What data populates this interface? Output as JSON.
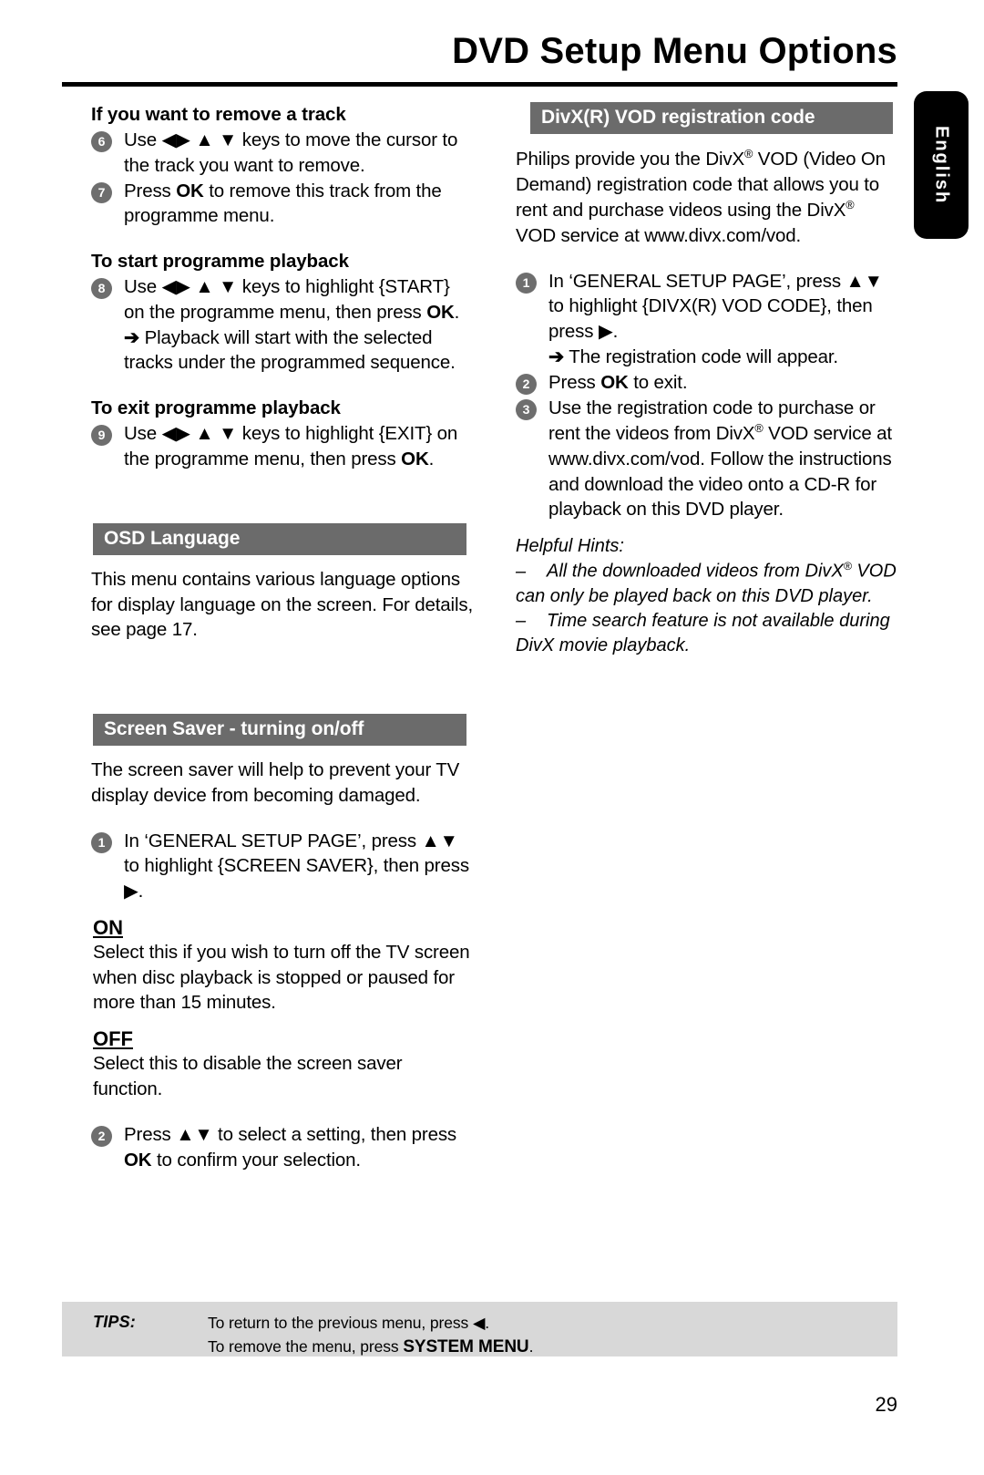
{
  "header": {
    "title": "DVD Setup Menu Options",
    "language_tab": "English"
  },
  "left_column": {
    "remove_track": {
      "heading": "If you want to remove a track",
      "steps": [
        {
          "num": "6",
          "text_pre": "Use ",
          "keys": "◀▶ ▲ ▼",
          "text_post": " keys to move the cursor to the track you want to remove."
        },
        {
          "num": "7",
          "text_pre": "Press ",
          "kbd": "OK",
          "text_post": " to remove this track from the programme menu."
        }
      ]
    },
    "start_playback": {
      "heading": "To start programme playback",
      "step_num": "8",
      "step_pre": "Use ",
      "step_keys": "◀▶ ▲ ▼",
      "step_mid": " keys to highlight {START} on the programme menu, then press ",
      "step_kbd": "OK",
      "step_end": ".",
      "result_arrow": "➔",
      "result": "Playback will start with the selected tracks under the programmed sequence."
    },
    "exit_playback": {
      "heading": "To exit programme playback",
      "step_num": "9",
      "step_pre": "Use ",
      "step_keys": "◀▶ ▲ ▼",
      "step_mid": " keys to highlight {EXIT} on the programme menu, then press ",
      "step_kbd": "OK",
      "step_end": "."
    },
    "osd_language": {
      "bar_title": "OSD Language",
      "body": "This menu contains various language options for display language on the screen.  For details, see page 17."
    },
    "screen_saver": {
      "bar_title": "Screen Saver - turning on/off",
      "body": "The screen saver will help to prevent your TV display device from becoming damaged.",
      "step1_num": "1",
      "step1_pre": "In ‘GENERAL SETUP PAGE’, press ",
      "step1_keys": "▲▼",
      "step1_mid": " to highlight {SCREEN SAVER}, then press ",
      "step1_key_right": "▶",
      "step1_end": ".",
      "on_label": "ON",
      "on_body": "Select this if you wish to turn off the TV screen when disc playback is stopped or paused for more than 15 minutes.",
      "off_label": "OFF",
      "off_body": "Select this to disable the screen saver function.",
      "step2_num": "2",
      "step2_pre": "Press ",
      "step2_keys": "▲▼",
      "step2_mid": "  to select a setting, then press ",
      "step2_kbd": "OK",
      "step2_end": " to confirm your selection."
    }
  },
  "right_column": {
    "divx_vod": {
      "bar_title": "DivX(R) VOD registration code",
      "intro_a": "Philips provide you the DivX",
      "intro_reg1": "®",
      "intro_b": " VOD (Video On Demand) registration code that allows you to rent and purchase videos using the DivX",
      "intro_reg2": "®",
      "intro_c": " VOD service at www.divx.com/vod.",
      "step1_num": "1",
      "step1_pre": "In ‘GENERAL SETUP PAGE’, press ",
      "step1_keys": "▲▼",
      "step1_mid": " to highlight {DIVX(R) VOD CODE}, then press ",
      "step1_key_right": "▶",
      "step1_end": ".",
      "step1_arrow": "➔",
      "step1_result": "The registration code will appear.",
      "step2_num": "2",
      "step2_pre": "Press ",
      "step2_kbd": "OK",
      "step2_end": " to exit.",
      "step3_num": "3",
      "step3_a": "Use the registration code to purchase or rent the videos from DivX",
      "step3_reg": "®",
      "step3_b": " VOD service at www.divx.com/vod. Follow the instructions and download the video onto a CD-R for playback on this DVD player."
    },
    "helpful_hints": {
      "title": "Helpful Hints:",
      "dash": "–",
      "items": [
        {
          "text_a": "All the downloaded videos from DivX",
          "reg": "®",
          "text_b": " VOD can only be played back on this DVD player."
        },
        {
          "text_a": "Time search feature is not available during DivX movie playback.",
          "reg": "",
          "text_b": ""
        }
      ]
    }
  },
  "footer": {
    "tips_label": "TIPS:",
    "line1_pre": "To return to the previous menu, press ",
    "line1_key": "◀",
    "line1_post": ".",
    "line2_pre": "To remove the menu, press ",
    "line2_strong": "SYSTEM MENU",
    "line2_post": ".",
    "page_number": "29"
  },
  "colors": {
    "bar_gray": "#6b6b6b",
    "bullet_gray": "#6e6e6e",
    "tips_gray": "#d8d8d8",
    "tab_black": "#000000"
  }
}
